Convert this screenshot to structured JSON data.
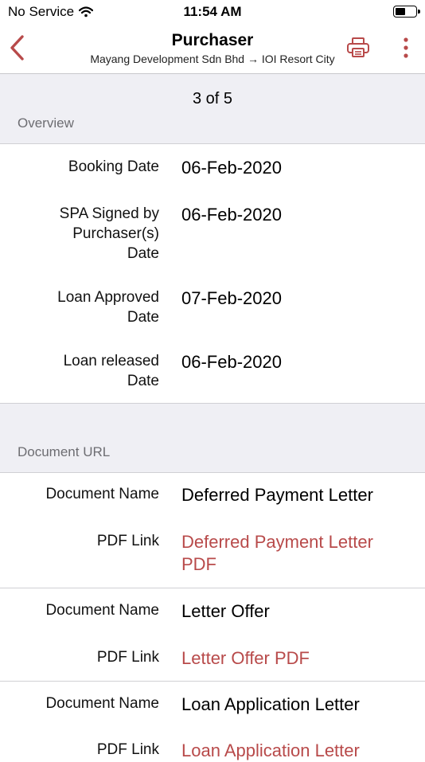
{
  "status_bar": {
    "carrier": "No Service",
    "time": "11:54 AM"
  },
  "nav": {
    "title": "Purchaser",
    "subtitle": "Mayang Development Sdn Bhd → IOI Resort City",
    "accent_color": "#b84a4a"
  },
  "pager": {
    "text": "3 of 5"
  },
  "overview": {
    "header": "Overview",
    "rows": [
      {
        "label": "Booking Date",
        "value": "06-Feb-2020"
      },
      {
        "label": "SPA Signed by\nPurchaser(s)\nDate",
        "value": "06-Feb-2020"
      },
      {
        "label": "Loan Approved\nDate",
        "value": "07-Feb-2020"
      },
      {
        "label": "Loan released\nDate",
        "value": "06-Feb-2020"
      }
    ]
  },
  "documents": {
    "header": "Document URL",
    "items": [
      {
        "name_label": "Document Name",
        "name": "Deferred Payment Letter",
        "link_label": "PDF Link",
        "link": "Deferred Payment Letter PDF"
      },
      {
        "name_label": "Document Name",
        "name": "Letter Offer",
        "link_label": "PDF Link",
        "link": "Letter Offer PDF"
      },
      {
        "name_label": "Document Name",
        "name": "Loan Application Letter",
        "link_label": "PDF Link",
        "link": "Loan Application Letter"
      }
    ]
  }
}
